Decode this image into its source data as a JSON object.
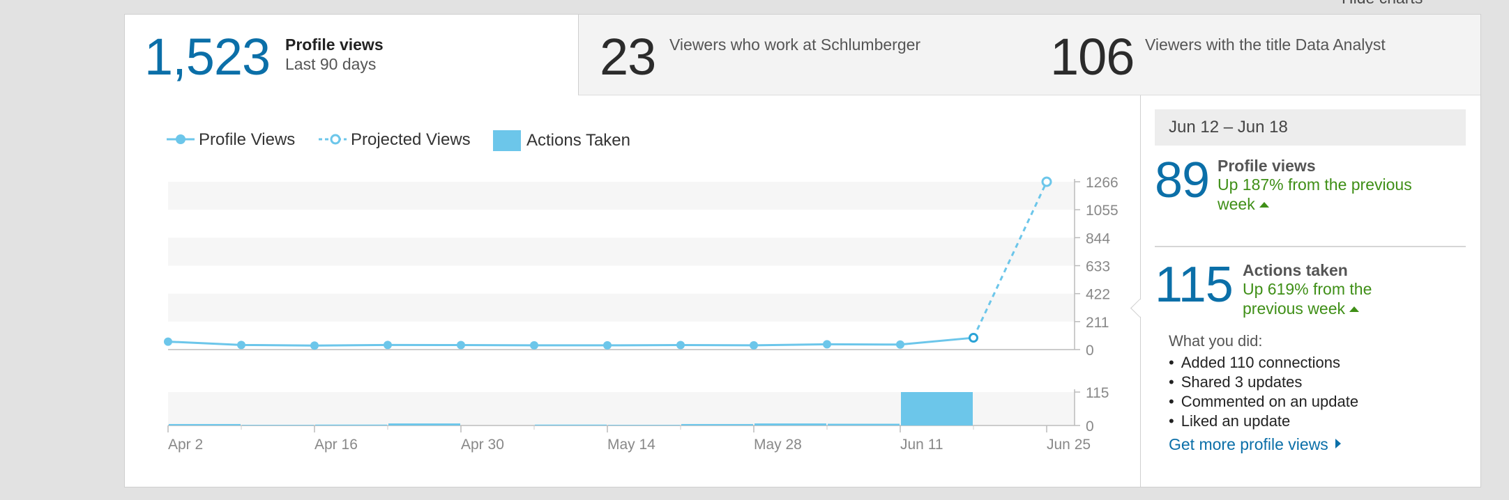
{
  "header": {
    "hide_charts_label": "Hide charts"
  },
  "summary": {
    "views_count": "1,523",
    "views_title": "Profile views",
    "views_period": "Last 90 days",
    "company_count": "23",
    "company_label": "Viewers who work at Schlumberger",
    "title_count": "106",
    "title_label": "Viewers with the title Data Analyst"
  },
  "legend": {
    "profile_views": "Profile Views",
    "projected_views": "Projected Views",
    "actions_taken": "Actions Taken"
  },
  "colors": {
    "accent": "#0b6fa8",
    "chart": "#6cc6ea",
    "positive": "#3f8f17"
  },
  "chart_data": {
    "type": "line",
    "x": [
      "Apr 2",
      "Apr 9",
      "Apr 16",
      "Apr 23",
      "Apr 30",
      "May 7",
      "May 14",
      "May 21",
      "May 28",
      "Jun 4",
      "Jun 11",
      "Jun 18"
    ],
    "x_tick_labels": [
      "Apr 2",
      "Apr 16",
      "Apr 30",
      "May 14",
      "May 28",
      "Jun 11",
      "Jun 25"
    ],
    "series": [
      {
        "name": "Profile Views",
        "values": [
          60,
          35,
          30,
          35,
          34,
          32,
          32,
          34,
          32,
          40,
          38,
          89
        ]
      },
      {
        "name": "Projected Views",
        "x": [
          "Jun 18",
          "Jun 25"
        ],
        "values": [
          89,
          1266
        ]
      }
    ],
    "y_ticks": [
      0,
      211,
      422,
      633,
      844,
      1055,
      1266
    ],
    "ylim": [
      0,
      1266
    ],
    "grid": "alternating bands",
    "legend_position": "top-left",
    "secondary": {
      "name": "Actions Taken",
      "type": "bar",
      "categories": [
        "Apr 2",
        "Apr 9",
        "Apr 16",
        "Apr 23",
        "Apr 30",
        "May 7",
        "May 14",
        "May 21",
        "May 28",
        "Jun 4",
        "Jun 11"
      ],
      "values": [
        5,
        2,
        3,
        7,
        0,
        3,
        2,
        5,
        7,
        6,
        115
      ],
      "y_ticks": [
        0,
        115
      ],
      "ylim": [
        0,
        115
      ]
    }
  },
  "sidebar": {
    "week_range": "Jun 12 – Jun 18",
    "views_value": "89",
    "views_title": "Profile views",
    "views_change": "Up 187% from the previous week",
    "actions_value": "115",
    "actions_title": "Actions taken",
    "actions_change": "Up 619% from the previous week",
    "did_label": "What you did:",
    "activities": [
      "Added 110 connections",
      "Shared 3 updates",
      "Commented on an update",
      "Liked an update"
    ],
    "more_link": "Get more profile views"
  }
}
